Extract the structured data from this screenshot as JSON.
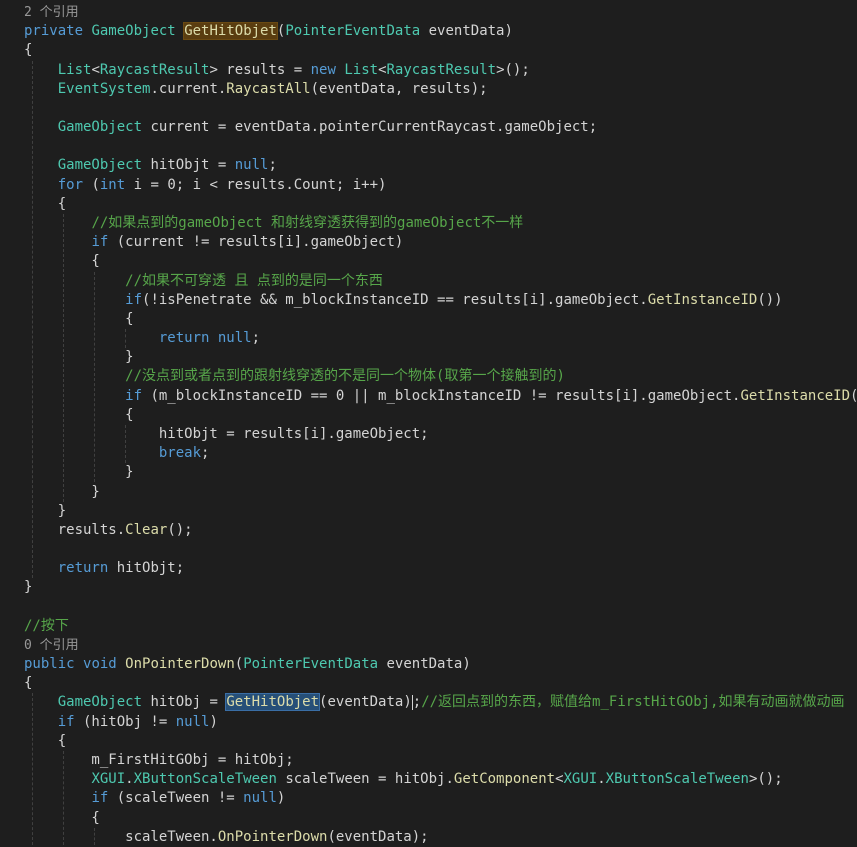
{
  "editor": {
    "lines": [
      {
        "id": "codelens-1",
        "type": "codelens",
        "text": "2 个引用"
      },
      {
        "id": "sig-1",
        "tokens": [
          {
            "t": "private",
            "c": "kw"
          },
          {
            "t": " "
          },
          {
            "t": "GameObject",
            "c": "ty"
          },
          {
            "t": " "
          },
          {
            "t": "GetHitObjet",
            "c": "fn",
            "hl": "def"
          },
          {
            "t": "("
          },
          {
            "t": "PointerEventData",
            "c": "ty"
          },
          {
            "t": " eventData)"
          }
        ]
      },
      {
        "tokens": [
          {
            "t": "{"
          }
        ]
      },
      {
        "tokens": [
          {
            "t": "    "
          },
          {
            "t": "List",
            "c": "ty"
          },
          {
            "t": "<"
          },
          {
            "t": "RaycastResult",
            "c": "ty"
          },
          {
            "t": "> results = "
          },
          {
            "t": "new",
            "c": "kw"
          },
          {
            "t": " "
          },
          {
            "t": "List",
            "c": "ty"
          },
          {
            "t": "<"
          },
          {
            "t": "RaycastResult",
            "c": "ty"
          },
          {
            "t": ">();"
          }
        ]
      },
      {
        "tokens": [
          {
            "t": "    "
          },
          {
            "t": "EventSystem",
            "c": "ty"
          },
          {
            "t": ".current."
          },
          {
            "t": "RaycastAll",
            "c": "fn"
          },
          {
            "t": "(eventData, results);"
          }
        ]
      },
      {
        "tokens": []
      },
      {
        "tokens": [
          {
            "t": "    "
          },
          {
            "t": "GameObject",
            "c": "ty"
          },
          {
            "t": " current = eventData.pointerCurrentRaycast.gameObject;"
          }
        ]
      },
      {
        "tokens": []
      },
      {
        "tokens": [
          {
            "t": "    "
          },
          {
            "t": "GameObject",
            "c": "ty"
          },
          {
            "t": " hitObjt = "
          },
          {
            "t": "null",
            "c": "kw"
          },
          {
            "t": ";"
          }
        ]
      },
      {
        "tokens": [
          {
            "t": "    "
          },
          {
            "t": "for",
            "c": "kw"
          },
          {
            "t": " ("
          },
          {
            "t": "int",
            "c": "kw"
          },
          {
            "t": " i = 0; i < results.Count; i++)"
          }
        ]
      },
      {
        "tokens": [
          {
            "t": "    {"
          }
        ]
      },
      {
        "tokens": [
          {
            "t": "        "
          },
          {
            "t": "//如果点到的gameObject 和射线穿透获得到的gameObject不一样",
            "c": "cmt"
          }
        ]
      },
      {
        "tokens": [
          {
            "t": "        "
          },
          {
            "t": "if",
            "c": "kw"
          },
          {
            "t": " (current != results[i].gameObject)"
          }
        ]
      },
      {
        "tokens": [
          {
            "t": "        {"
          }
        ]
      },
      {
        "tokens": [
          {
            "t": "            "
          },
          {
            "t": "//如果不可穿透 且 点到的是同一个东西",
            "c": "cmt"
          }
        ]
      },
      {
        "tokens": [
          {
            "t": "            "
          },
          {
            "t": "if",
            "c": "kw"
          },
          {
            "t": "(!isPenetrate && m_blockInstanceID == results[i].gameObject."
          },
          {
            "t": "GetInstanceID",
            "c": "fn"
          },
          {
            "t": "())"
          }
        ]
      },
      {
        "tokens": [
          {
            "t": "            {"
          }
        ]
      },
      {
        "tokens": [
          {
            "t": "                "
          },
          {
            "t": "return",
            "c": "kw"
          },
          {
            "t": " "
          },
          {
            "t": "null",
            "c": "kw"
          },
          {
            "t": ";"
          }
        ]
      },
      {
        "tokens": [
          {
            "t": "            }"
          }
        ]
      },
      {
        "tokens": [
          {
            "t": "            "
          },
          {
            "t": "//没点到或者点到的跟射线穿透的不是同一个物体(取第一个接触到的)",
            "c": "cmt"
          }
        ]
      },
      {
        "tokens": [
          {
            "t": "            "
          },
          {
            "t": "if",
            "c": "kw"
          },
          {
            "t": " (m_blockInstanceID == 0 || m_blockInstanceID != results[i].gameObject."
          },
          {
            "t": "GetInstanceID",
            "c": "fn"
          },
          {
            "t": "())"
          }
        ]
      },
      {
        "tokens": [
          {
            "t": "            {"
          }
        ]
      },
      {
        "tokens": [
          {
            "t": "                hitObjt = results[i].gameObject;"
          }
        ]
      },
      {
        "tokens": [
          {
            "t": "                "
          },
          {
            "t": "break",
            "c": "kw"
          },
          {
            "t": ";"
          }
        ]
      },
      {
        "tokens": [
          {
            "t": "            }"
          }
        ]
      },
      {
        "tokens": [
          {
            "t": "        }"
          }
        ]
      },
      {
        "tokens": [
          {
            "t": "    }"
          }
        ]
      },
      {
        "tokens": [
          {
            "t": "    results."
          },
          {
            "t": "Clear",
            "c": "fn"
          },
          {
            "t": "();"
          }
        ]
      },
      {
        "tokens": []
      },
      {
        "tokens": [
          {
            "t": "    "
          },
          {
            "t": "return",
            "c": "kw"
          },
          {
            "t": " hitObjt;"
          }
        ]
      },
      {
        "tokens": [
          {
            "t": "}"
          }
        ]
      },
      {
        "tokens": []
      },
      {
        "tokens": [
          {
            "t": "//按下",
            "c": "cmt"
          }
        ]
      },
      {
        "id": "codelens-2",
        "type": "codelens",
        "text": "0 个引用"
      },
      {
        "id": "sig-2",
        "tokens": [
          {
            "t": "public",
            "c": "kw"
          },
          {
            "t": " "
          },
          {
            "t": "void",
            "c": "kw"
          },
          {
            "t": " "
          },
          {
            "t": "OnPointerDown",
            "c": "fn"
          },
          {
            "t": "("
          },
          {
            "t": "PointerEventData",
            "c": "ty"
          },
          {
            "t": " eventData)"
          }
        ]
      },
      {
        "tokens": [
          {
            "t": "{"
          }
        ]
      },
      {
        "tokens": [
          {
            "t": "    "
          },
          {
            "t": "GameObject",
            "c": "ty"
          },
          {
            "t": " hitObj = "
          },
          {
            "t": "GetHitObjet",
            "c": "fn",
            "hl": "ref"
          },
          {
            "t": "(eventData)"
          },
          {
            "t": "",
            "caret": true
          },
          {
            "t": ";"
          },
          {
            "t": "//返回点到的东西，赋值给m_FirstHitGObj,如果有动画就做动画",
            "c": "cmt"
          }
        ]
      },
      {
        "tokens": [
          {
            "t": "    "
          },
          {
            "t": "if",
            "c": "kw"
          },
          {
            "t": " (hitObj != "
          },
          {
            "t": "null",
            "c": "kw"
          },
          {
            "t": ")"
          }
        ]
      },
      {
        "tokens": [
          {
            "t": "    {"
          }
        ]
      },
      {
        "tokens": [
          {
            "t": "        m_FirstHitGObj = hitObj;"
          }
        ]
      },
      {
        "tokens": [
          {
            "t": "        "
          },
          {
            "t": "XGUI",
            "c": "ty"
          },
          {
            "t": "."
          },
          {
            "t": "XButtonScaleTween",
            "c": "ty"
          },
          {
            "t": " scaleTween = hitObj."
          },
          {
            "t": "GetComponent",
            "c": "fn"
          },
          {
            "t": "<"
          },
          {
            "t": "XGUI",
            "c": "ty"
          },
          {
            "t": "."
          },
          {
            "t": "XButtonScaleTween",
            "c": "ty"
          },
          {
            "t": ">();"
          }
        ]
      },
      {
        "tokens": [
          {
            "t": "        "
          },
          {
            "t": "if",
            "c": "kw"
          },
          {
            "t": " (scaleTween != "
          },
          {
            "t": "null",
            "c": "kw"
          },
          {
            "t": ")"
          }
        ]
      },
      {
        "tokens": [
          {
            "t": "        {"
          }
        ]
      },
      {
        "tokens": [
          {
            "t": "            scaleTween."
          },
          {
            "t": "OnPointerDown",
            "c": "fn"
          },
          {
            "t": "(eventData);"
          }
        ]
      }
    ]
  },
  "colors": {
    "background": "#1e1e1e",
    "keyword": "#569cd6",
    "type": "#4ec9b0",
    "method": "#dcdcaa",
    "comment": "#57a64a",
    "text": "#d4d4d4",
    "codelens": "#999999",
    "definition_highlight": "#5a3d10",
    "reference_highlight": "#264f78"
  }
}
